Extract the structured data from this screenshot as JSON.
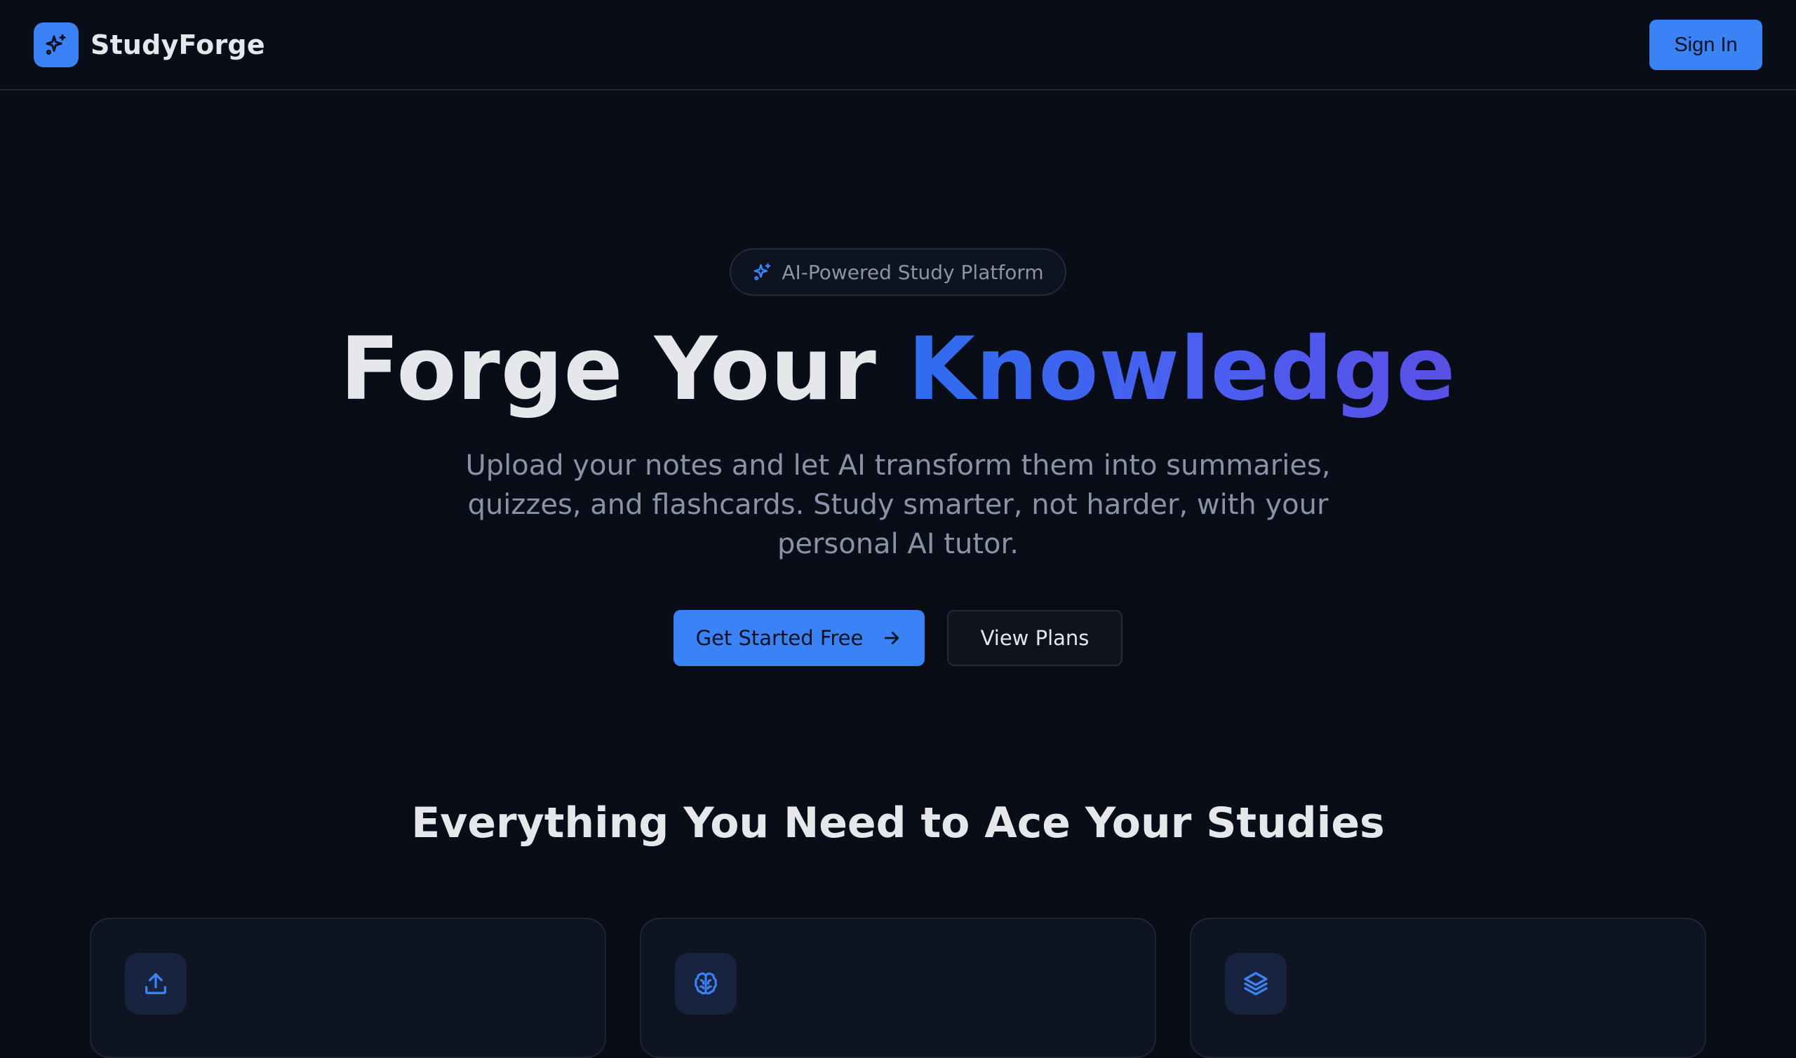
{
  "header": {
    "brand_name": "StudyForge",
    "logo_icon": "sparkles-icon",
    "sign_in_label": "Sign In"
  },
  "hero": {
    "badge_icon": "sparkles-icon",
    "badge_text": "AI-Powered Study Platform",
    "title_plain": "Forge Your ",
    "title_highlight": "Knowledge",
    "subtitle": "Upload your notes and let AI transform them into summaries, quizzes, and flashcards. Study smarter, not harder, with your personal AI tutor.",
    "primary_cta": "Get Started Free",
    "primary_cta_icon": "arrow-right-icon",
    "secondary_cta": "View Plans"
  },
  "features": {
    "title": "Everything You Need to Ace Your Studies",
    "cards": [
      {
        "icon": "upload-icon"
      },
      {
        "icon": "brain-icon"
      },
      {
        "icon": "layers-icon"
      }
    ]
  },
  "colors": {
    "background": "#090d18",
    "accent": "#3b82f6",
    "gradient_start": "#2f6cf0",
    "gradient_end": "#5a4fe6",
    "muted_text": "#8a92a6"
  }
}
